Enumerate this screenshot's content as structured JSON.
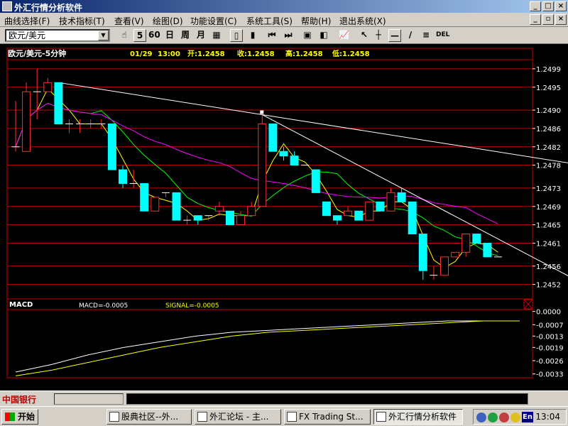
{
  "window": {
    "title": "外汇行情分析软件"
  },
  "menu": {
    "items": [
      "曲线选择(F)",
      "技术指标(T)",
      "查看(V)",
      "绘图(D)",
      "功能设置(C)",
      "系统工具(S)",
      "帮助(H)",
      "退出系统(X)"
    ]
  },
  "toolbar": {
    "pair": "欧元/美元",
    "interval_label": "5",
    "period_60": "60",
    "day": "日",
    "week": "周",
    "month": "月",
    "del_label": "DEL"
  },
  "chart_info": {
    "title": "欧元/美元-5分钟",
    "date": "01/29",
    "time": "13:00",
    "open": "开:1.2458",
    "close": "收:1.2458",
    "high": "高:1.2458",
    "low": "低:1.2458"
  },
  "macd_info": {
    "label": "MACD",
    "macd": "MACD=-0.0005",
    "signal": "SIGNAL=-0.0005"
  },
  "colors": {
    "up": "#ff3030",
    "down": "#00ffff",
    "frame": "#c00000",
    "ma_fast": "#ffff00",
    "ma_mid": "#00ff00",
    "ma_slow": "#ff00ff",
    "macd_line": "#ffffff",
    "signal_line": "#ffff00"
  },
  "chart_data": [
    {
      "type": "candlestick",
      "title": "欧元/美元-5分钟",
      "ylim": [
        1.2449,
        1.2501
      ],
      "y_ticks": [
        "1.2499",
        "1.2495",
        "1.2490",
        "1.2486",
        "1.2482",
        "1.2478",
        "1.2473",
        "1.2469",
        "1.2465",
        "1.2461",
        "1.2456",
        "1.2452"
      ],
      "candles": [
        {
          "o": 1.2482,
          "h": 1.2492,
          "l": 1.2481,
          "c": 1.2482
        },
        {
          "o": 1.2481,
          "h": 1.2496,
          "l": 1.2481,
          "c": 1.2494
        },
        {
          "o": 1.2494,
          "h": 1.2499,
          "l": 1.2488,
          "c": 1.2494
        },
        {
          "o": 1.2494,
          "h": 1.2497,
          "l": 1.2494,
          "c": 1.2496
        },
        {
          "o": 1.2496,
          "h": 1.2496,
          "l": 1.2487,
          "c": 1.2487
        },
        {
          "o": 1.2487,
          "h": 1.2488,
          "l": 1.2485,
          "c": 1.2487
        },
        {
          "o": 1.2487,
          "h": 1.2488,
          "l": 1.2485,
          "c": 1.2487
        },
        {
          "o": 1.2487,
          "h": 1.2488,
          "l": 1.2486,
          "c": 1.2487
        },
        {
          "o": 1.2487,
          "h": 1.2488,
          "l": 1.2486,
          "c": 1.2487
        },
        {
          "o": 1.2487,
          "h": 1.2487,
          "l": 1.2477,
          "c": 1.2477
        },
        {
          "o": 1.2477,
          "h": 1.2478,
          "l": 1.2473,
          "c": 1.2474
        },
        {
          "o": 1.2474,
          "h": 1.2477,
          "l": 1.2473,
          "c": 1.2474
        },
        {
          "o": 1.2474,
          "h": 1.2474,
          "l": 1.2468,
          "c": 1.2468
        },
        {
          "o": 1.2468,
          "h": 1.2471,
          "l": 1.2468,
          "c": 1.2471
        },
        {
          "o": 1.2472,
          "h": 1.2472,
          "l": 1.2471,
          "c": 1.2472
        },
        {
          "o": 1.2472,
          "h": 1.2472,
          "l": 1.2466,
          "c": 1.2466
        },
        {
          "o": 1.2466,
          "h": 1.2467,
          "l": 1.2465,
          "c": 1.2466
        },
        {
          "o": 1.2467,
          "h": 1.2467,
          "l": 1.2465,
          "c": 1.2466
        },
        {
          "o": 1.2467,
          "h": 1.2467,
          "l": 1.2466,
          "c": 1.2467
        },
        {
          "o": 1.2468,
          "h": 1.247,
          "l": 1.2467,
          "c": 1.2469
        },
        {
          "o": 1.2468,
          "h": 1.2468,
          "l": 1.2465,
          "c": 1.2465
        },
        {
          "o": 1.2465,
          "h": 1.2468,
          "l": 1.2465,
          "c": 1.2467
        },
        {
          "o": 1.2467,
          "h": 1.247,
          "l": 1.2467,
          "c": 1.2469
        },
        {
          "o": 1.2469,
          "h": 1.2489,
          "l": 1.2469,
          "c": 1.2487
        },
        {
          "o": 1.2487,
          "h": 1.2487,
          "l": 1.2481,
          "c": 1.2481
        },
        {
          "o": 1.2481,
          "h": 1.2482,
          "l": 1.2479,
          "c": 1.248
        },
        {
          "o": 1.248,
          "h": 1.2481,
          "l": 1.2478,
          "c": 1.2478
        },
        {
          "o": 1.2478,
          "h": 1.2478,
          "l": 1.2478,
          "c": 1.2478
        },
        {
          "o": 1.2477,
          "h": 1.2477,
          "l": 1.2472,
          "c": 1.2472
        },
        {
          "o": 1.247,
          "h": 1.247,
          "l": 1.2467,
          "c": 1.2467
        },
        {
          "o": 1.2467,
          "h": 1.2467,
          "l": 1.2465,
          "c": 1.2466
        },
        {
          "o": 1.2467,
          "h": 1.2469,
          "l": 1.2467,
          "c": 1.2468
        },
        {
          "o": 1.2468,
          "h": 1.2468,
          "l": 1.2466,
          "c": 1.2466
        },
        {
          "o": 1.2466,
          "h": 1.247,
          "l": 1.2466,
          "c": 1.247
        },
        {
          "o": 1.247,
          "h": 1.247,
          "l": 1.2468,
          "c": 1.2468
        },
        {
          "o": 1.2468,
          "h": 1.2473,
          "l": 1.2468,
          "c": 1.2472
        },
        {
          "o": 1.2472,
          "h": 1.2473,
          "l": 1.247,
          "c": 1.247
        },
        {
          "o": 1.247,
          "h": 1.247,
          "l": 1.2463,
          "c": 1.2463
        },
        {
          "o": 1.2463,
          "h": 1.2463,
          "l": 1.2453,
          "c": 1.2455
        },
        {
          "o": 1.2454,
          "h": 1.2456,
          "l": 1.2453,
          "c": 1.2454
        },
        {
          "o": 1.2454,
          "h": 1.2458,
          "l": 1.2454,
          "c": 1.2458
        },
        {
          "o": 1.2458,
          "h": 1.2459,
          "l": 1.2458,
          "c": 1.2459
        },
        {
          "o": 1.2459,
          "h": 1.2463,
          "l": 1.2458,
          "c": 1.2463
        },
        {
          "o": 1.2463,
          "h": 1.2463,
          "l": 1.2461,
          "c": 1.2461
        },
        {
          "o": 1.2461,
          "h": 1.2461,
          "l": 1.2458,
          "c": 1.2458
        },
        {
          "o": 1.2458,
          "h": 1.2458,
          "l": 1.2458,
          "c": 1.2458
        }
      ]
    },
    {
      "type": "line",
      "title": "MACD",
      "ylim": [
        -0.0035,
        0.0001
      ],
      "y_ticks": [
        "0.0000",
        "-0.0007",
        "-0.0013",
        "-0.0019",
        "-0.0026",
        "-0.0033"
      ],
      "series": [
        {
          "name": "MACD",
          "values": [
            -0.0032,
            -0.0028,
            -0.0023,
            -0.0019,
            -0.0016,
            -0.0013,
            -0.0011,
            -0.001,
            -0.0009,
            -0.0008,
            -0.0007,
            -0.0006,
            -0.0005,
            -0.0005,
            -0.0005
          ]
        },
        {
          "name": "SIGNAL",
          "values": [
            -0.0034,
            -0.0031,
            -0.0027,
            -0.0023,
            -0.0019,
            -0.0016,
            -0.0013,
            -0.0011,
            -0.001,
            -0.0009,
            -0.0008,
            -0.0007,
            -0.0006,
            -0.0005,
            -0.0005
          ]
        }
      ]
    }
  ],
  "brand": {
    "logo": "中国银行"
  },
  "taskbar": {
    "start": "开始",
    "tasks": [
      "股典社区--外...",
      "外汇论坛 - 主...",
      "FX Trading St...",
      "外汇行情分析软件"
    ],
    "lang": "En",
    "clock": "13:04"
  }
}
